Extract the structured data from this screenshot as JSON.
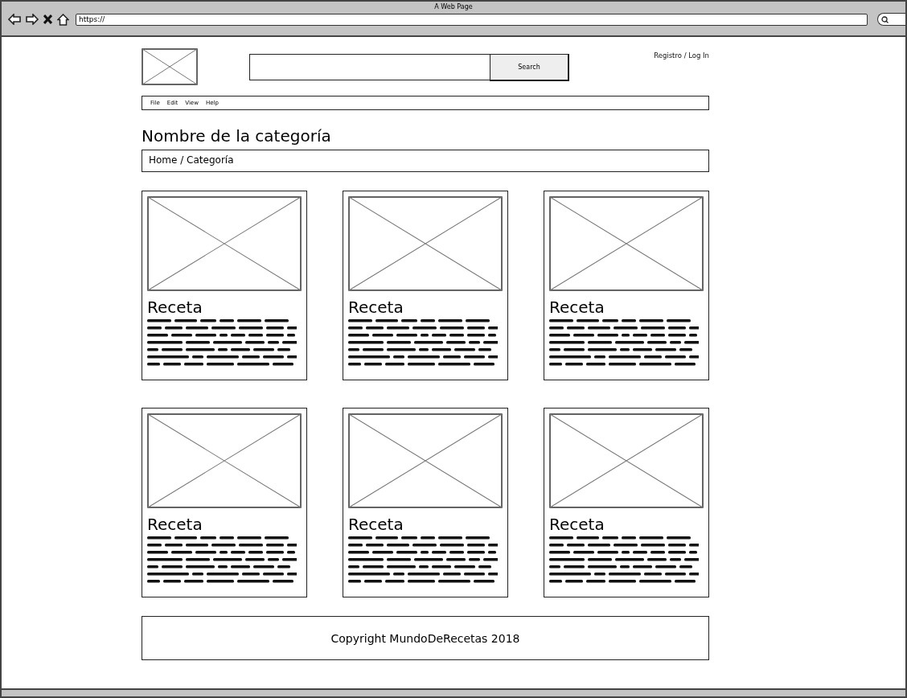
{
  "window": {
    "title": "A Web Page",
    "url": "https://"
  },
  "header": {
    "search_button": "Search",
    "account_link": "Registro / Log In"
  },
  "menu": [
    "File",
    "Edit",
    "View",
    "Help"
  ],
  "page_title": "Nombre de la categoría",
  "breadcrumb": "Home / Categoría",
  "cards": [
    {
      "title": "Receta"
    },
    {
      "title": "Receta"
    },
    {
      "title": "Receta"
    },
    {
      "title": "Receta"
    },
    {
      "title": "Receta"
    },
    {
      "title": "Receta"
    }
  ],
  "footer": "Copyright MundoDeRecetas 2018"
}
